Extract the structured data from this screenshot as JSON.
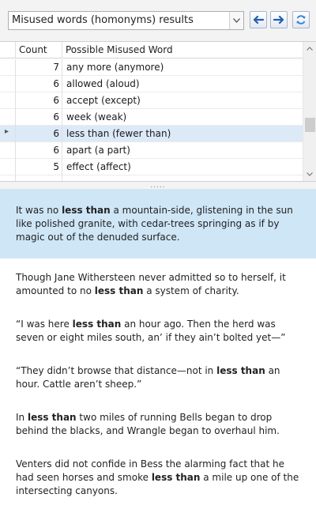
{
  "toolbar": {
    "report_select_value": "Misused words (homonyms) results",
    "icons": {
      "dropdown": "chevron-down-icon",
      "back": "arrow-left-icon",
      "forward": "arrow-right-icon",
      "refresh": "refresh-icon"
    }
  },
  "grid": {
    "columns": [
      "Count",
      "Possible Misused Word"
    ],
    "rows": [
      {
        "count": "7",
        "word": "any more (anymore)"
      },
      {
        "count": "6",
        "word": "allowed (aloud)"
      },
      {
        "count": "6",
        "word": "accept (except)"
      },
      {
        "count": "6",
        "word": "week (weak)"
      },
      {
        "count": "6",
        "word": "less than (fewer than)",
        "selected": true
      },
      {
        "count": "6",
        "word": "apart (a part)"
      },
      {
        "count": "5",
        "word": "effect (affect)"
      }
    ],
    "selected_row_marker": "▸"
  },
  "splitter": {
    "grip": "....."
  },
  "examples": [
    {
      "before": "It was no ",
      "term": "less than",
      "after": " a mountain-side, glistening in the sun like polished granite, with cedar-trees springing as if by magic out of the denuded surface."
    },
    {
      "before": "Though Jane Withersteen never admitted so to herself, it amounted to no ",
      "term": "less than",
      "after": " a system of charity."
    },
    {
      "before": "“I was here ",
      "term": "less than",
      "after": " an hour ago. Then the herd was seven or eight miles south, an’ if they ain’t bolted yet—”"
    },
    {
      "before": "“They didn’t browse that distance—not in ",
      "term": "less than",
      "after": " an hour. Cattle aren’t sheep.”"
    },
    {
      "before": "In ",
      "term": "less than",
      "after": " two miles of running Bells began to drop behind the blacks, and Wrangle began to overhaul him."
    },
    {
      "before": "Venters did not confide in Bess the alarming fact that he had seen horses and smoke ",
      "term": "less than",
      "after": " a mile up one of the intersecting canyons."
    }
  ],
  "colors": {
    "selected_row": "#dce9f7",
    "selected_example": "#cfe6f7",
    "nav_arrow": "#1f5fb4",
    "refresh_icon": "#2e7fd1"
  }
}
